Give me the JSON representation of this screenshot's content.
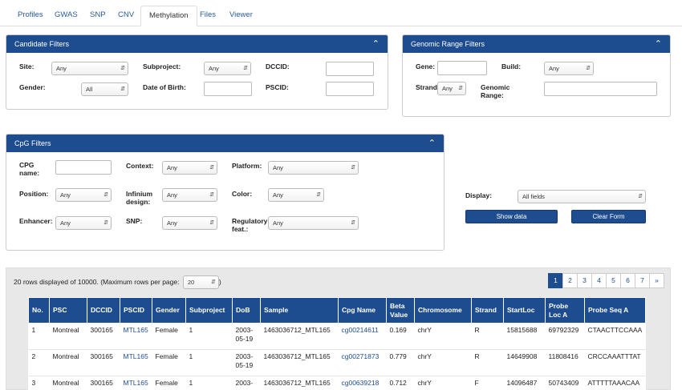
{
  "tabs": [
    "Profiles",
    "GWAS",
    "SNP",
    "CNV",
    "Methylation",
    "Files",
    "Viewer"
  ],
  "candidate": {
    "title": "Candidate Filters",
    "site_label": "Site:",
    "site_value": "Any",
    "subproject_label": "Subproject:",
    "subproject_value": "Any",
    "dccid_label": "DCCID:",
    "gender_label": "Gender:",
    "gender_value": "All",
    "dob_label": "Date of Birth:",
    "pscid_label": "PSCID:"
  },
  "genomic": {
    "title": "Genomic Range Filters",
    "gene_label": "Gene:",
    "build_label": "Build:",
    "build_value": "Any",
    "strand_label": "Strand",
    "strand_value": "Any",
    "range_label_1": "Genomic",
    "range_label_2": "Range:"
  },
  "cpg": {
    "title": "CpG Filters",
    "name_label_1": "CPG",
    "name_label_2": "name:",
    "context_label": "Context:",
    "context_value": "Any",
    "platform_label": "Platform:",
    "platform_value": "Any",
    "position_label": "Position:",
    "position_value": "Any",
    "infinium_label_1": "Infinium",
    "infinium_label_2": "design:",
    "infinium_value": "Any",
    "color_label": "Color:",
    "color_value": "Any",
    "enhancer_label": "Enhancer:",
    "enhancer_value": "Any",
    "snp_label": "SNP:",
    "snp_value": "Any",
    "regulatory_label_1": "Regulatory",
    "regulatory_label_2": "feat.:",
    "regulatory_value": "Any"
  },
  "display": {
    "label": "Display:",
    "value": "All fields",
    "show_button": "Show data",
    "clear_button": "Clear Form"
  },
  "results": {
    "info": "20 rows displayed of 10000. (Maximum rows per page:",
    "info_close": ")",
    "rows_per_page": "20",
    "pages": [
      "1",
      "2",
      "3",
      "4",
      "5",
      "6",
      "7",
      "»"
    ],
    "columns": [
      "No.",
      "PSC",
      "DCCID",
      "PSCID",
      "Gender",
      "Subproject",
      "DoB",
      "Sample",
      "Cpg Name",
      "Beta Value",
      "Chromosome",
      "Strand",
      "StartLoc",
      "Probe Loc A",
      "Probe Seq A"
    ],
    "rows": [
      [
        "1",
        "Montreal",
        "300165",
        "MTL165",
        "Female",
        "1",
        "2003-05-19",
        "1463036712_MTL165",
        "cg00214611",
        "0.169",
        "chrY",
        "R",
        "15815688",
        "69792329",
        "CTAACTTCCAAA"
      ],
      [
        "2",
        "Montreal",
        "300165",
        "MTL165",
        "Female",
        "1",
        "2003-05-19",
        "1463036712_MTL165",
        "cg00271873",
        "0.779",
        "chrY",
        "R",
        "14649908",
        "11808416",
        "CRCCAAATTTAT"
      ],
      [
        "3",
        "Montreal",
        "300165",
        "MTL165",
        "Female",
        "1",
        "2003-",
        "1463036712_MTL165",
        "cg00639218",
        "0.712",
        "chrY",
        "F",
        "14096487",
        "50743409",
        "ATTTTTAAACAA"
      ]
    ]
  }
}
